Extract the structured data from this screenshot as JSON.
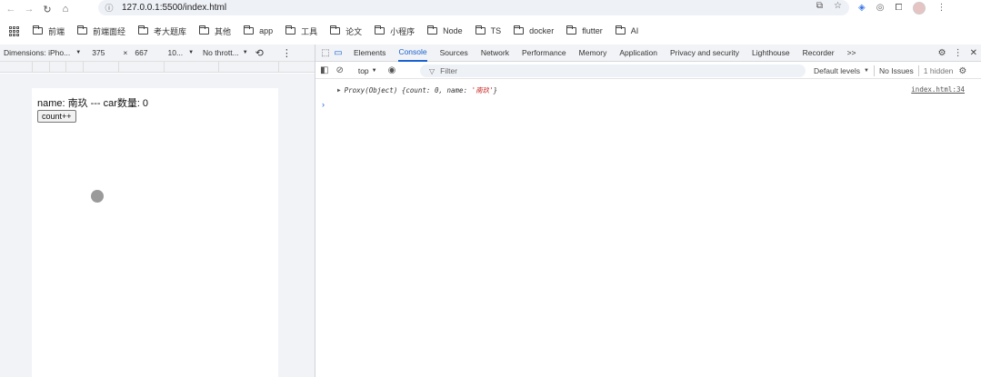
{
  "browser": {
    "url": "127.0.0.1:5500/index.html"
  },
  "bookmarks": [
    {
      "label": "前端"
    },
    {
      "label": "前端面经"
    },
    {
      "label": "考大题库"
    },
    {
      "label": "其他"
    },
    {
      "label": "app"
    },
    {
      "label": "工具"
    },
    {
      "label": "论文"
    },
    {
      "label": "小程序"
    },
    {
      "label": "Node"
    },
    {
      "label": "TS"
    },
    {
      "label": "docker"
    },
    {
      "label": "flutter"
    },
    {
      "label": "AI"
    }
  ],
  "device_toolbar": {
    "dimensions_label": "Dimensions: iPho...",
    "width": "375",
    "times": "×",
    "height": "667",
    "zoom": "10...",
    "throttle": "No thrott..."
  },
  "device_page": {
    "name_label": "name:",
    "name_value": "南玖",
    "separator": "---",
    "car_label": "car数量:",
    "car_value": "0",
    "button_label": "count++"
  },
  "devtools": {
    "tabs": [
      {
        "label": "Elements",
        "active": false
      },
      {
        "label": "Console",
        "active": true
      },
      {
        "label": "Sources",
        "active": false
      },
      {
        "label": "Network",
        "active": false
      },
      {
        "label": "Performance",
        "active": false
      },
      {
        "label": "Memory",
        "active": false
      },
      {
        "label": "Application",
        "active": false
      },
      {
        "label": "Privacy and security",
        "active": false
      },
      {
        "label": "Lighthouse",
        "active": false
      },
      {
        "label": "Recorder",
        "active": false
      }
    ],
    "more_tabs": ">>",
    "accent_color": "#1a62d0"
  },
  "console": {
    "context": "top",
    "filter_placeholder": "Filter",
    "levels": "Default levels",
    "issues": "No Issues",
    "hidden": "1 hidden",
    "log": {
      "prefix": "Proxy(Object) {count: 0, name: ",
      "string": "'南玖'",
      "suffix": "}",
      "source": "index.html:34"
    },
    "prompt": "›"
  }
}
